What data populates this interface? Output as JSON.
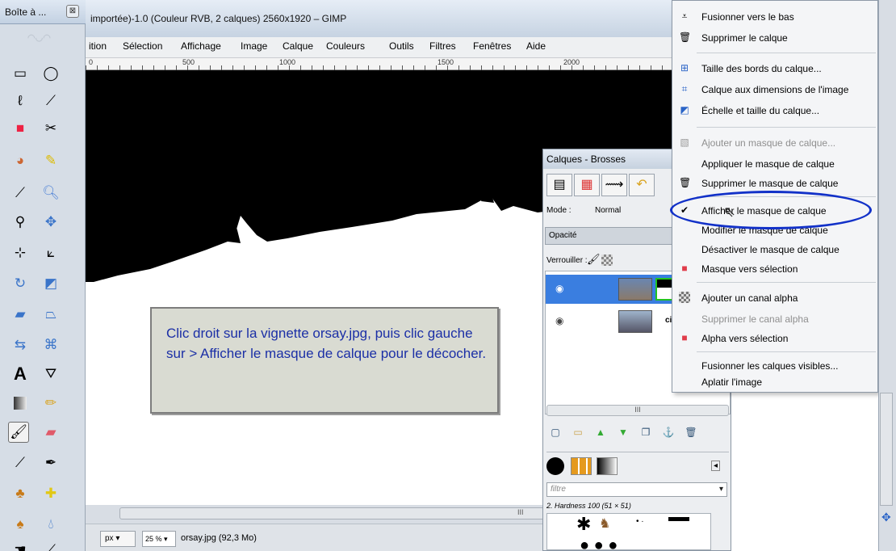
{
  "toolbox": {
    "title": "Boîte à ...",
    "close_glyph": "⊠",
    "logo_text": "GIMP"
  },
  "window": {
    "title": "importée)-1.0 (Couleur RVB, 2 calques) 2560x1920 – GIMP"
  },
  "menubar": {
    "items": [
      "ition",
      "Sélection",
      "Affichage",
      "Image",
      "Calque",
      "Couleurs",
      "Outils",
      "Filtres",
      "Fenêtres",
      "Aide"
    ]
  },
  "ruler": {
    "labels": [
      "0",
      "500",
      "1000",
      "1500",
      "2000"
    ]
  },
  "status": {
    "unit": "px",
    "zoom": "25 %",
    "file": "orsay.jpg (92,3 Mo)"
  },
  "scrollbar": {
    "grip": "III"
  },
  "note": {
    "text": "Clic droit sur la vignette orsay.jpg, puis clic gauche sur > Afficher le masque de calque pour le décocher."
  },
  "layers_dock": {
    "title": "Calques - Brosses",
    "mode_label": "Mode :",
    "mode_value": "Normal",
    "opacity_label": "Opacité",
    "lock_label": "Verrouiller :",
    "layer2_name": "ciel",
    "filter_placeholder": "filtre",
    "brush_label": "2. Hardness 100 (51 × 51)",
    "scroll_grip": "III"
  },
  "context_menu": {
    "items": [
      {
        "label": "Fusionner vers le bas",
        "icon": "merge-down-icon",
        "disabled": false
      },
      {
        "label": "Supprimer le calque",
        "icon": "trash-icon",
        "disabled": false
      },
      {
        "label": "Taille des bords du calque...",
        "icon": "layer-boundary-icon",
        "disabled": false
      },
      {
        "label": "Calque aux dimensions de l'image",
        "icon": "layer-to-image-size-icon",
        "disabled": false
      },
      {
        "label": "Échelle et taille du calque...",
        "icon": "scale-layer-icon",
        "disabled": false
      },
      {
        "label": "Ajouter un masque de calque...",
        "icon": "add-mask-icon",
        "disabled": true
      },
      {
        "label": "Appliquer le masque de calque",
        "icon": "",
        "disabled": false
      },
      {
        "label": "Supprimer le masque de calque",
        "icon": "trash-icon",
        "disabled": false
      },
      {
        "label": "Afficher le masque de calque",
        "icon": "checkmark-icon",
        "disabled": false
      },
      {
        "label": "Modifier le masque de calque",
        "icon": "",
        "disabled": false
      },
      {
        "label": "Désactiver le masque de calque",
        "icon": "",
        "disabled": false
      },
      {
        "label": "Masque vers sélection",
        "icon": "mask-to-selection-icon",
        "disabled": false
      },
      {
        "label": "Ajouter un canal alpha",
        "icon": "add-alpha-icon",
        "disabled": false
      },
      {
        "label": "Supprimer le canal alpha",
        "icon": "",
        "disabled": true
      },
      {
        "label": "Alpha vers sélection",
        "icon": "alpha-to-selection-icon",
        "disabled": false
      },
      {
        "label": "Fusionner les calques visibles...",
        "icon": "",
        "disabled": false
      },
      {
        "label": "Aplatir l'image",
        "icon": "",
        "disabled": false
      }
    ]
  },
  "colors": {
    "accent_circle": "#1231c8",
    "note_text": "#1b2fa6",
    "selected_layer": "#3a7ee0"
  }
}
